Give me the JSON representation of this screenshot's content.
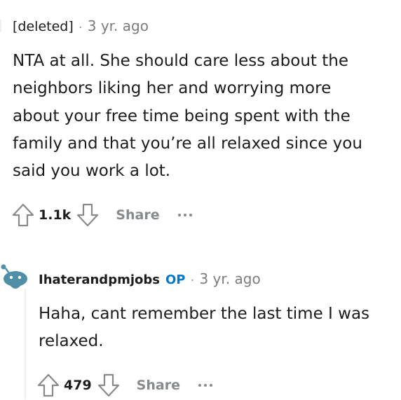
{
  "comments": [
    {
      "author": "[deleted]",
      "separator": "·",
      "timestamp": "3 yr. ago",
      "body": [
        "NTA at all. She should care less about the",
        "neighbors liking her and worrying more",
        "about your free time being spent with the",
        "family and that you’re all relaxed since you",
        "said you work a lot."
      ],
      "score": "1.1k",
      "share_label": "Share",
      "upvote_icon": "upvote-arrow-icon",
      "downvote_icon": "downvote-arrow-icon",
      "more_icon": "more-options-icon"
    },
    {
      "author": "Ihaterandpmjobs",
      "badge": "OP",
      "separator": "·",
      "timestamp": "3 yr. ago",
      "avatar_icon": "snoo-avatar-icon",
      "body": [
        "Haha, cant remember the last time I was",
        "relaxed."
      ],
      "score": "479",
      "share_label": "Share",
      "upvote_icon": "upvote-arrow-icon",
      "downvote_icon": "downvote-arrow-icon",
      "more_icon": "more-options-icon"
    }
  ],
  "colors": {
    "text": "#1c1c1c",
    "muted": "#878a8c",
    "op_badge": "#0079d3",
    "avatar": "#4f8fa8",
    "thread_line": "#edeff1"
  }
}
